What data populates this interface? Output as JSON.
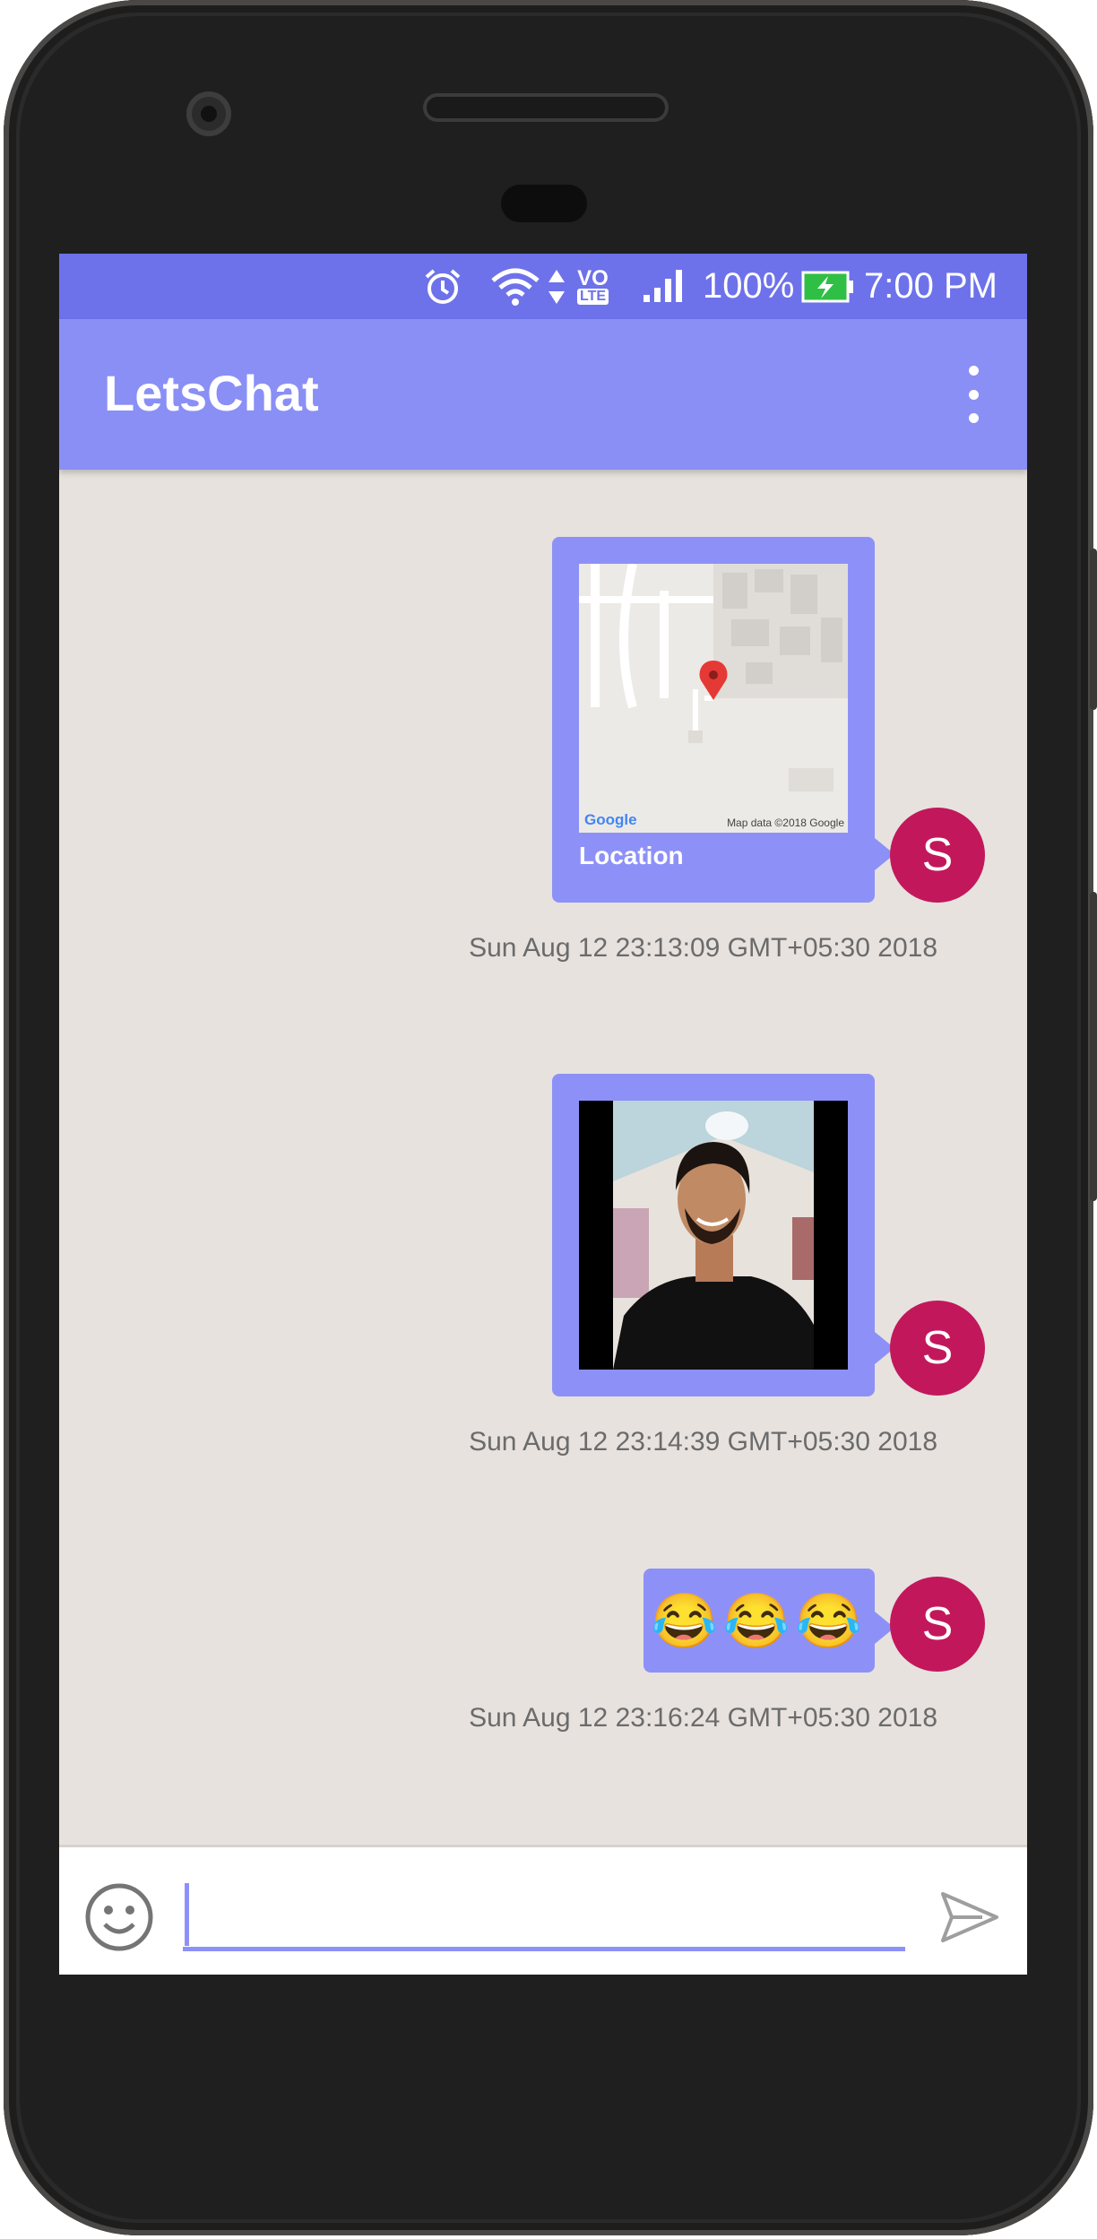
{
  "status_bar": {
    "battery": "100%",
    "time": "7:00 PM",
    "network_label_top": "VO",
    "network_label_bottom": "LTE"
  },
  "app_bar": {
    "title": "LetsChat"
  },
  "messages": [
    {
      "type": "location",
      "label": "Location",
      "map_logo": "Google",
      "map_attribution": "Map data ©2018 Google",
      "avatar_initial": "S",
      "timestamp": "Sun Aug 12 23:13:09 GMT+05:30 2018"
    },
    {
      "type": "image",
      "avatar_initial": "S",
      "timestamp": "Sun Aug 12 23:14:39 GMT+05:30 2018"
    },
    {
      "type": "text",
      "text": "😂😂😂",
      "avatar_initial": "S",
      "timestamp": "Sun Aug 12 23:16:24 GMT+05:30 2018"
    }
  ],
  "composer": {
    "value": "",
    "placeholder": "",
    "emoji_icon": "smiley-icon",
    "send_icon": "send-icon"
  },
  "colors": {
    "status_bar": "#6d72ea",
    "app_bar": "#8a8ff6",
    "bubble": "#8d91f7",
    "avatar": "#c2185b",
    "chat_background": "#e7e2de"
  }
}
